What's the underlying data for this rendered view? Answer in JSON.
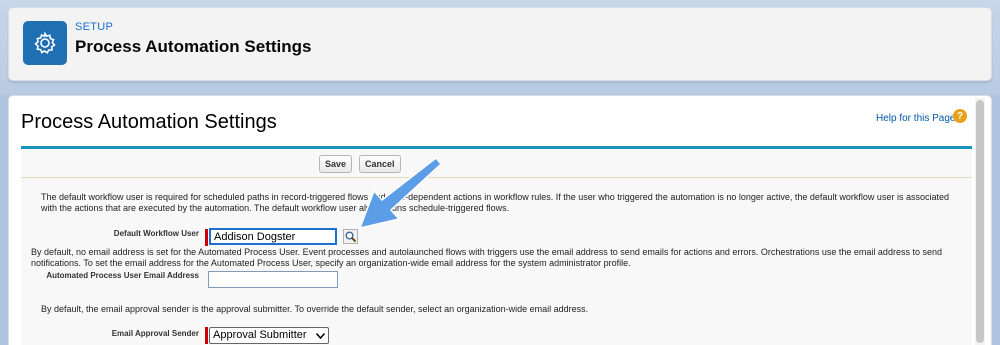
{
  "header": {
    "eyebrow": "SETUP",
    "title": "Process Automation Settings",
    "icon": "gear-icon"
  },
  "main": {
    "page_title": "Process Automation Settings",
    "help_link": "Help for this Page",
    "help_icon": "help-icon",
    "buttons": {
      "save": "Save",
      "cancel": "Cancel"
    },
    "default_workflow_user": {
      "description": "The default workflow user is required for scheduled paths in record-triggered flows and time-dependent actions in workflow rules. If the user who triggered the automation is no longer active, the default workflow user is associated with the actions that are executed by the automation. The default workflow user always runs schedule-triggered flows.",
      "label": "Default Workflow User",
      "value": "Addison Dogster",
      "lookup_icon": "magnifier-icon"
    },
    "automated_process_user_email": {
      "description": "By default, no email address is set for the Automated Process User. Event processes and autolaunched flows with triggers use the email address to send emails for actions and errors. Orchestrations use the email address to send notifications. To set the email address for the Automated Process User, specify an organization-wide email address for the system administrator profile.",
      "label": "Automated Process User Email Address",
      "value": ""
    },
    "email_approval_sender": {
      "description": "By default, the email approval sender is the approval submitter. To override the default sender, select an organization-wide email address.",
      "label": "Email Approval Sender",
      "selected": "Approval Submitter"
    }
  },
  "annotation": {
    "arrow_color": "#5b9de6"
  }
}
